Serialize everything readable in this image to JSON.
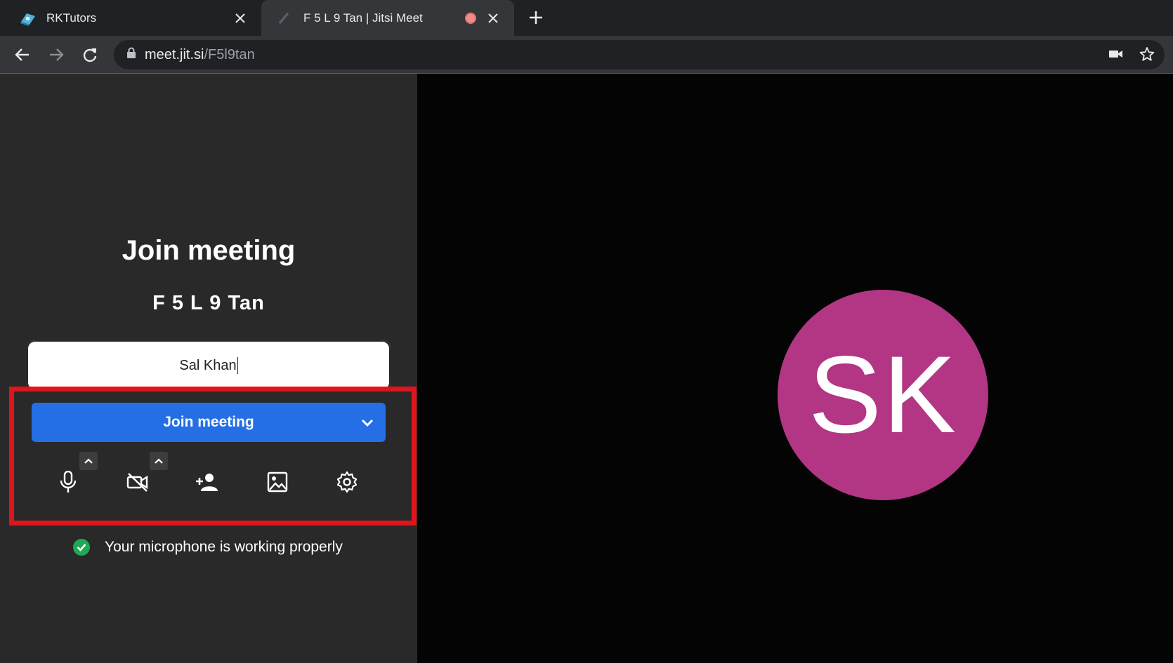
{
  "browser": {
    "tabs": [
      {
        "title": "RKTutors",
        "favicon": "rktutors-logo-icon",
        "active": false
      },
      {
        "title": "F 5 L 9 Tan | Jitsi Meet",
        "favicon": "jitsi-icon",
        "active": true,
        "recording": true
      }
    ],
    "address": {
      "domain": "meet.jit.si",
      "path": "/F5l9tan"
    }
  },
  "prejoin": {
    "title": "Join meeting",
    "room_name": "F 5 L 9 Tan",
    "name_input": {
      "value": "Sal Khan"
    },
    "join_button_label": "Join meeting",
    "controls": [
      "microphone-icon",
      "camera-off-icon",
      "invite-person-icon",
      "background-image-icon",
      "settings-gear-icon"
    ],
    "status_text": "Your microphone is working properly"
  },
  "video": {
    "avatar_initials": "SK",
    "avatar_color": "#b23683"
  },
  "colors": {
    "accent": "#246fe5",
    "highlight": "#e0141c",
    "ok": "#1fa855"
  }
}
